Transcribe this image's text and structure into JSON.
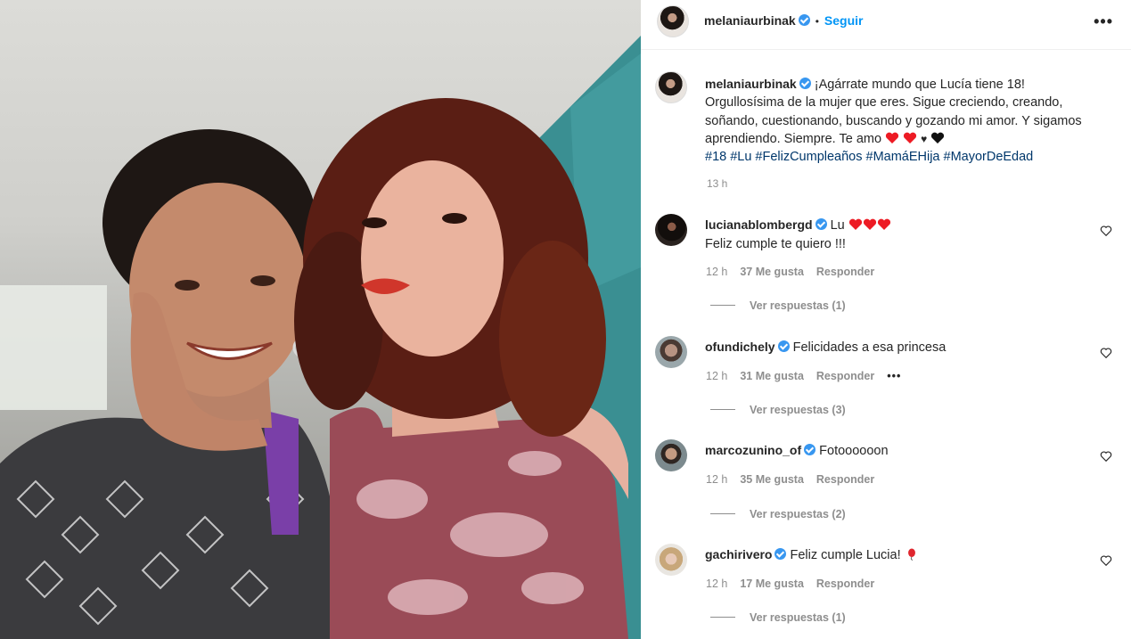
{
  "post": {
    "author": "melaniaurbinak",
    "follow_label": "Seguir",
    "header_more_icon": "more-horizontal-icon",
    "caption": {
      "author": "melaniaurbinak",
      "text": "¡Agárrate mundo que Lucía tiene 18! Orgullosísima de la mujer que eres. Sigue creciendo, creando, soñando, cuestionando, buscando y gozando mi amor. Y sigamos aprendiendo. Siempre. Te amo",
      "emoji_tail": "❤️ ❤️ ♥ 🖤",
      "hashtags": [
        "#18",
        "#Lu",
        "#FelizCumpleaños",
        "#MamáEHija",
        "#MayorDeEdad"
      ],
      "time": "13 h"
    }
  },
  "comments": [
    {
      "author": "lucianablombergd",
      "text_line1": "Lu",
      "emoji": "❤️❤️❤️",
      "text_line2": "Feliz cumple te quiero !!!",
      "time": "12 h",
      "likes": "37 Me gusta",
      "reply_label": "Responder",
      "view_replies": "Ver respuestas (1)"
    },
    {
      "author": "ofundichely",
      "text": "Felicidades a esa princesa",
      "time": "12 h",
      "likes": "31 Me gusta",
      "reply_label": "Responder",
      "more": "•••",
      "view_replies": "Ver respuestas (3)"
    },
    {
      "author": "marcozunino_of",
      "text": "Fotoooooon",
      "time": "12 h",
      "likes": "35 Me gusta",
      "reply_label": "Responder",
      "view_replies": "Ver respuestas (2)"
    },
    {
      "author": "gachirivero",
      "text": "Feliz cumple Lucia!",
      "emoji": "🎈",
      "time": "12 h",
      "likes": "17 Me gusta",
      "reply_label": "Responder",
      "view_replies": "Ver respuestas (1)"
    }
  ],
  "colors": {
    "link_blue": "#0095f6",
    "hashtag_blue": "#00376b",
    "muted_gray": "#8e8e8e",
    "text_dark": "#262626",
    "heart_red": "#ed1b24"
  }
}
